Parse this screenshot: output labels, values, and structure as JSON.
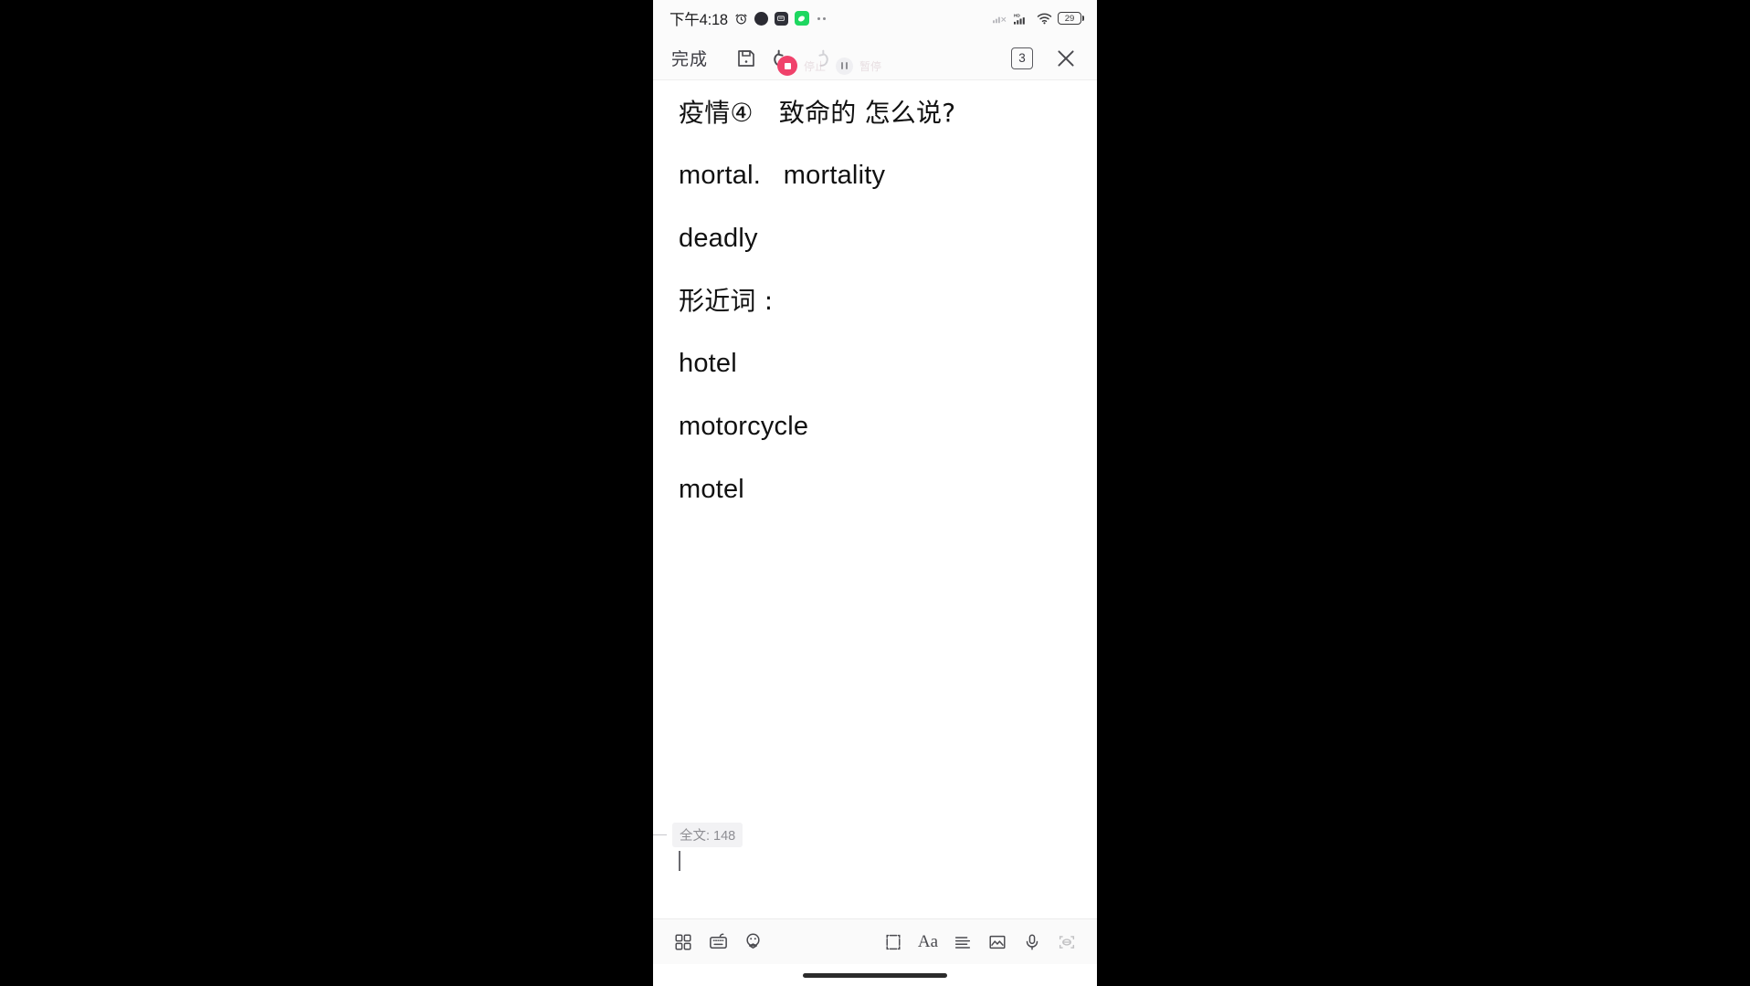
{
  "status_bar": {
    "time": "下午4:18",
    "icons_left": [
      "alarm-icon",
      "app-badge-dark-icon",
      "app-badge-square-icon",
      "app-badge-green-icon",
      "overflow-dots-icon"
    ],
    "icons_right": [
      "signal-no-service-icon",
      "signal-hd-icon",
      "wifi-icon",
      "battery-icon"
    ],
    "battery_level": "29"
  },
  "toolbar": {
    "done_label": "完成",
    "save_icon": "save-floppy-icon",
    "undo_icon": "undo-icon",
    "redo_icon": "redo-icon",
    "tab_count": "3",
    "close_icon": "close-icon"
  },
  "recorder": {
    "stop_label": "停止",
    "pause_label": "暂停",
    "stop_color": "#f0426b"
  },
  "note": {
    "lines": [
      "疫情④　致命的 怎么说?",
      "mortal.   mortality",
      "deadly",
      "形近词 :",
      "hotel",
      "motorcycle",
      "motel"
    ],
    "word_count_label": "全文: 148"
  },
  "bottom_toolbar": {
    "items": [
      {
        "name": "grid-apps-icon",
        "label": ""
      },
      {
        "name": "keyboard-icon",
        "label": ""
      },
      {
        "name": "sticker-emoji-icon",
        "label": ""
      },
      {
        "name": "crop-frame-icon",
        "label": ""
      },
      {
        "name": "text-format-icon",
        "label": "Aa"
      },
      {
        "name": "align-left-icon",
        "label": ""
      },
      {
        "name": "image-icon",
        "label": ""
      },
      {
        "name": "microphone-icon",
        "label": ""
      },
      {
        "name": "scan-ocr-icon",
        "label": ""
      }
    ]
  }
}
